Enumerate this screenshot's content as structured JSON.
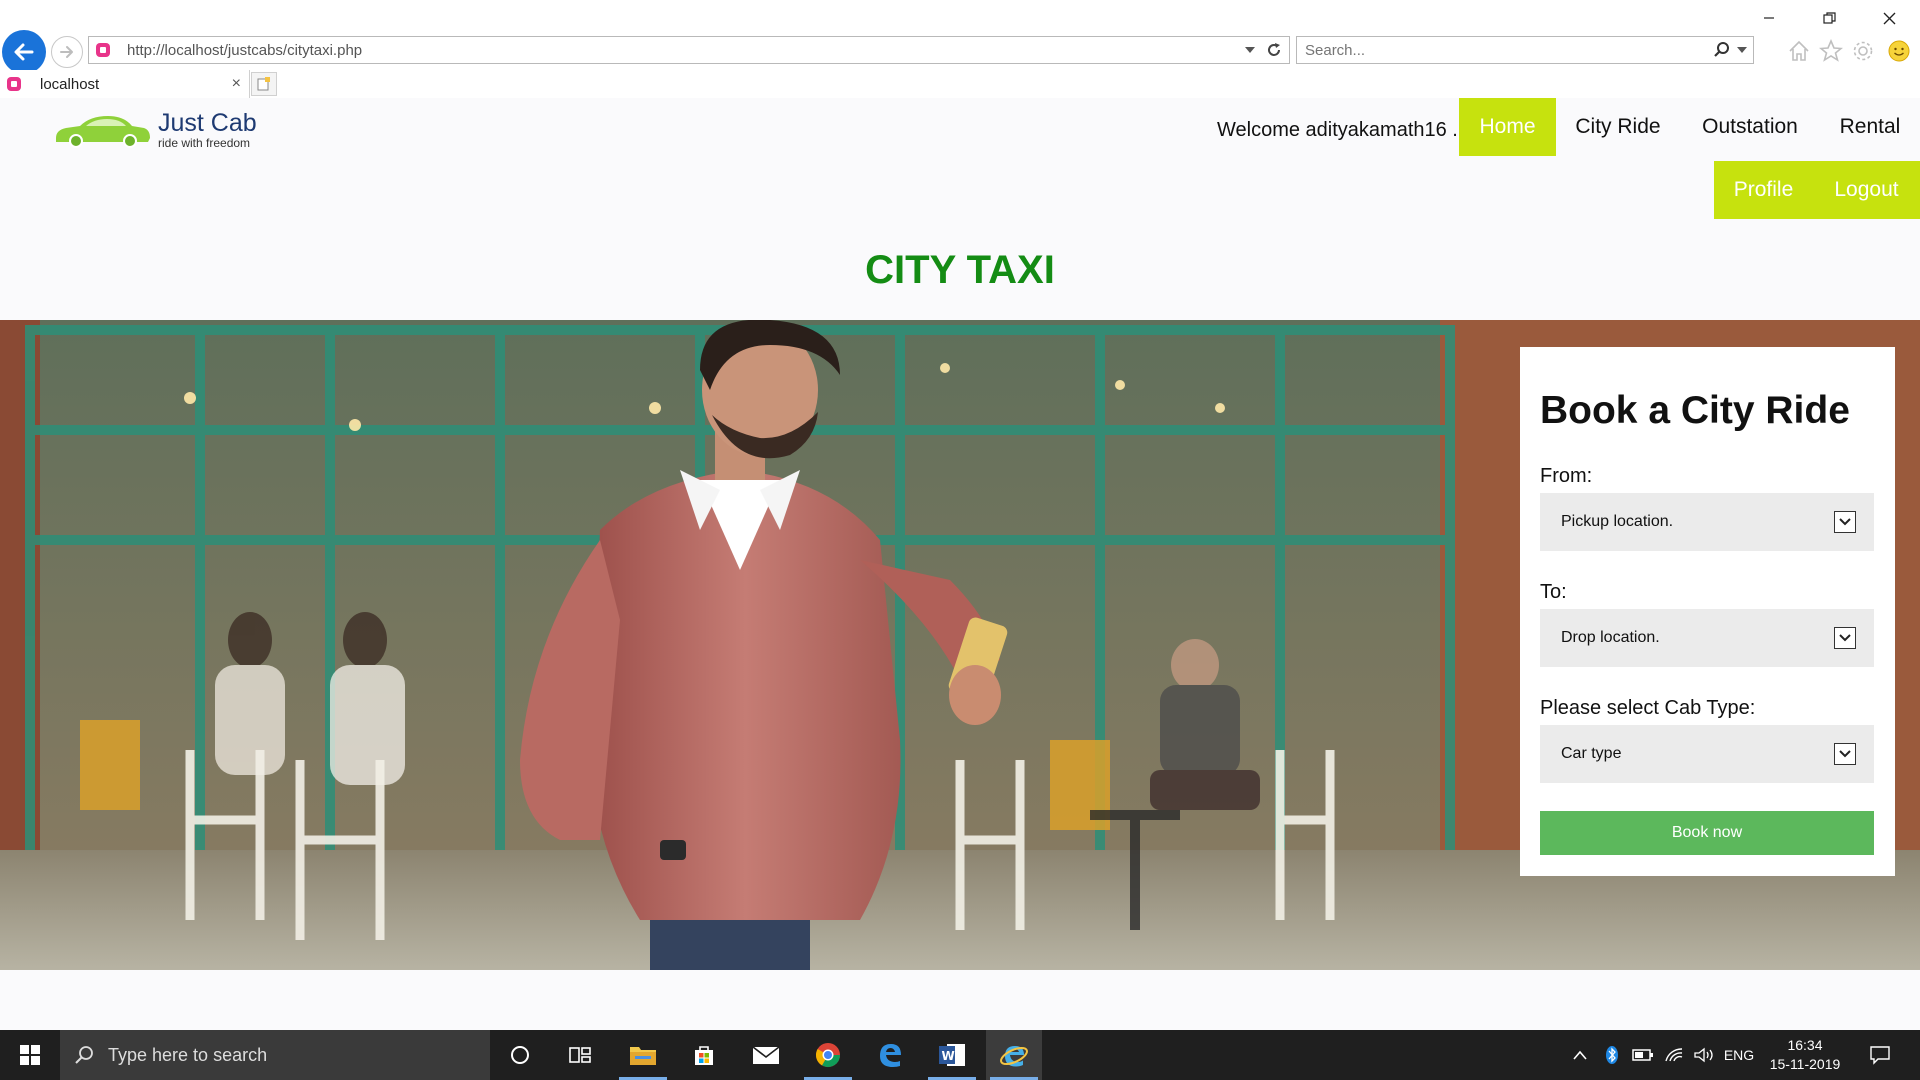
{
  "browser": {
    "url": "http://localhost/justcabs/citytaxi.php",
    "search_placeholder": "Search...",
    "tab_title": "localhost",
    "tab_close": "×"
  },
  "site": {
    "logo_name": "Just Cab",
    "logo_tagline": "ride with freedom",
    "welcome": "Welcome adityakamath16 .",
    "nav": {
      "home": "Home",
      "city_ride": "City Ride",
      "outstation": "Outstation",
      "rental": "Rental",
      "profile": "Profile",
      "logout": "Logout"
    },
    "active_nav": "Home",
    "page_title": "CITY TAXI",
    "accent_color": "#c6e20e",
    "title_color": "#148c14"
  },
  "booking": {
    "title": "Book a City Ride",
    "from_label": "From:",
    "from_value": "Pickup location.",
    "to_label": "To:",
    "to_value": "Drop location.",
    "cab_label": "Please select Cab Type:",
    "cab_value": "Car type",
    "button": "Book now",
    "button_color": "#5cb85c"
  },
  "taskbar": {
    "search_placeholder": "Type here to search",
    "language": "ENG",
    "time": "16:34",
    "date": "15-11-2019"
  }
}
